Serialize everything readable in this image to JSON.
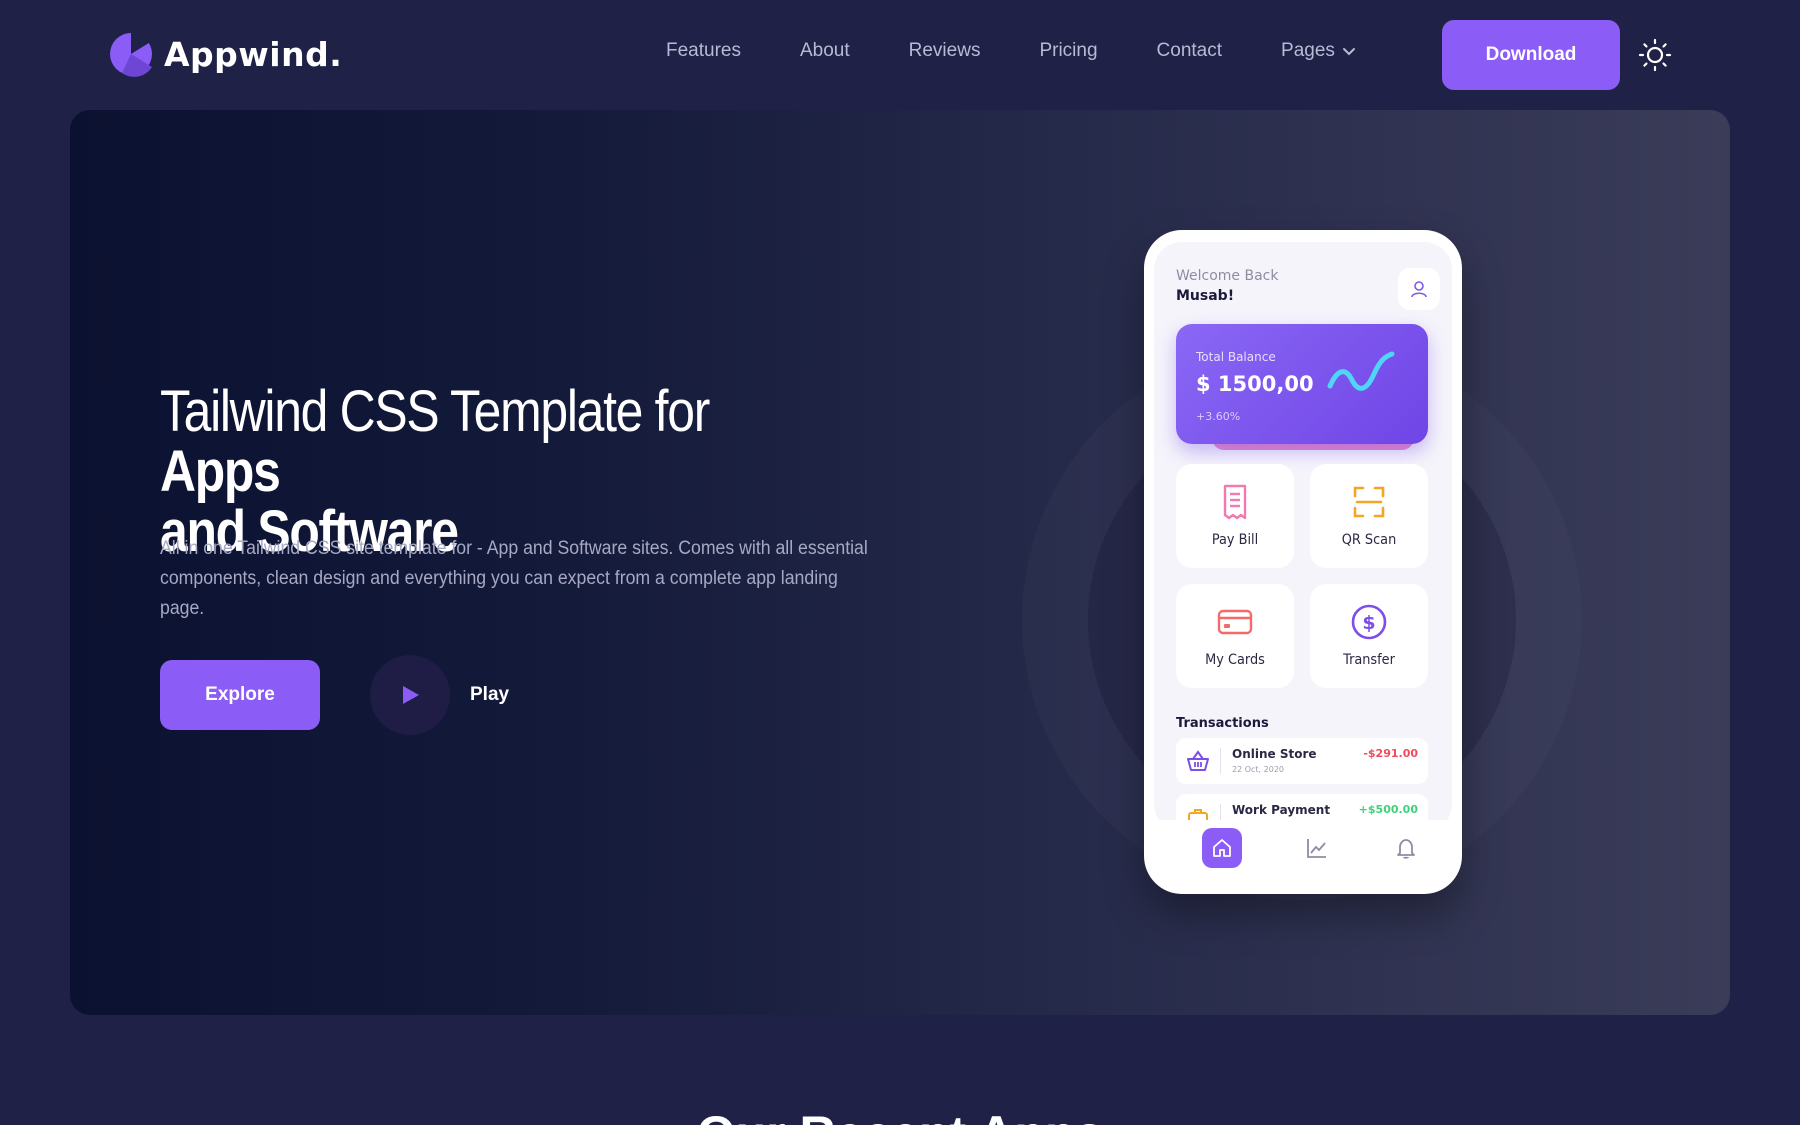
{
  "brand": {
    "name": "Appwind.",
    "accent": "#8b5cf6"
  },
  "nav": {
    "links": [
      "Features",
      "About",
      "Reviews",
      "Pricing",
      "Contact",
      "Pages"
    ],
    "download_label": "Download"
  },
  "hero": {
    "title_regular": "Tailwind CSS Template for ",
    "title_bold_1": "Apps",
    "title_bold_2": "and Software",
    "description": "All in one Tailwind CSS site template for - App and Software sites. Comes with all essential components, clean design and everything you can expect from a complete app landing page.",
    "explore_label": "Explore",
    "play_label": "Play"
  },
  "phone": {
    "welcome": "Welcome Back",
    "username": "Musab!",
    "balance": {
      "label": "Total Balance",
      "amount": "$ 1500,00",
      "change": "+3.60%"
    },
    "tiles": [
      {
        "label": "Pay Bill",
        "icon": "receipt-icon"
      },
      {
        "label": "QR Scan",
        "icon": "qr-scan-icon"
      },
      {
        "label": "My Cards",
        "icon": "card-icon"
      },
      {
        "label": "Transfer",
        "icon": "dollar-icon"
      }
    ],
    "transactions_title": "Transactions",
    "transactions": [
      {
        "name": "Online Store",
        "date": "22 Oct, 2020",
        "amount": "-$291.00"
      },
      {
        "name": "Work Payment",
        "date": "",
        "amount": "+$500.00"
      }
    ]
  },
  "next_section": {
    "heading": "Our Recent Apps"
  }
}
